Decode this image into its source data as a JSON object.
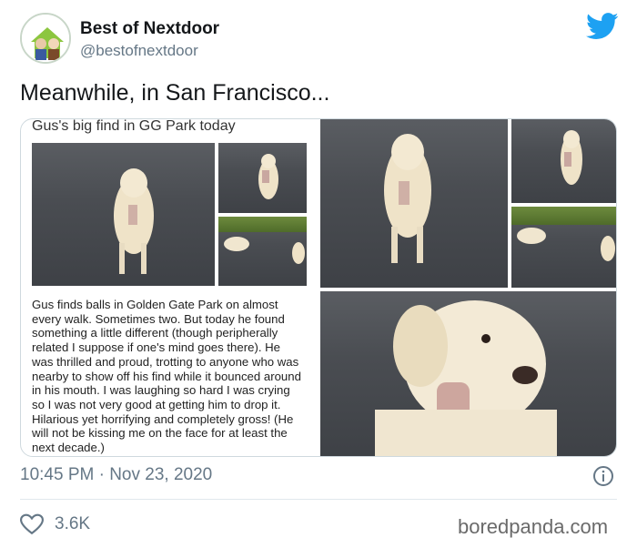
{
  "account": {
    "name": "Best of Nextdoor",
    "handle": "@bestofnextdoor"
  },
  "tweet": {
    "text": "Meanwhile, in San Francisco..."
  },
  "media": {
    "caption_title": "Gus's big find in GG Park today",
    "caption_body": "Gus finds balls in Golden Gate Park on almost every walk. Sometimes two. But today he found something a little different (though peripherally related I suppose if one's mind goes there). He was thrilled and proud, trotting to anyone who was nearby to show off his find while it bounced around in his mouth. I was laughing so hard I was crying so I was not very good at getting him to drop it. Hilarious yet horrifying and completely gross! (He will not be kissing me on the face for at least the next decade.)"
  },
  "footer": {
    "timestamp": "10:45 PM · Nov 23, 2020",
    "likes": "3.6K",
    "watermark": "boredpanda.com"
  },
  "colors": {
    "twitter_blue": "#1da1f2",
    "secondary_text": "#657786",
    "divider": "#e1e8ed"
  },
  "icons": [
    "avatar",
    "twitter-bird-icon",
    "info-icon",
    "heart-icon"
  ]
}
